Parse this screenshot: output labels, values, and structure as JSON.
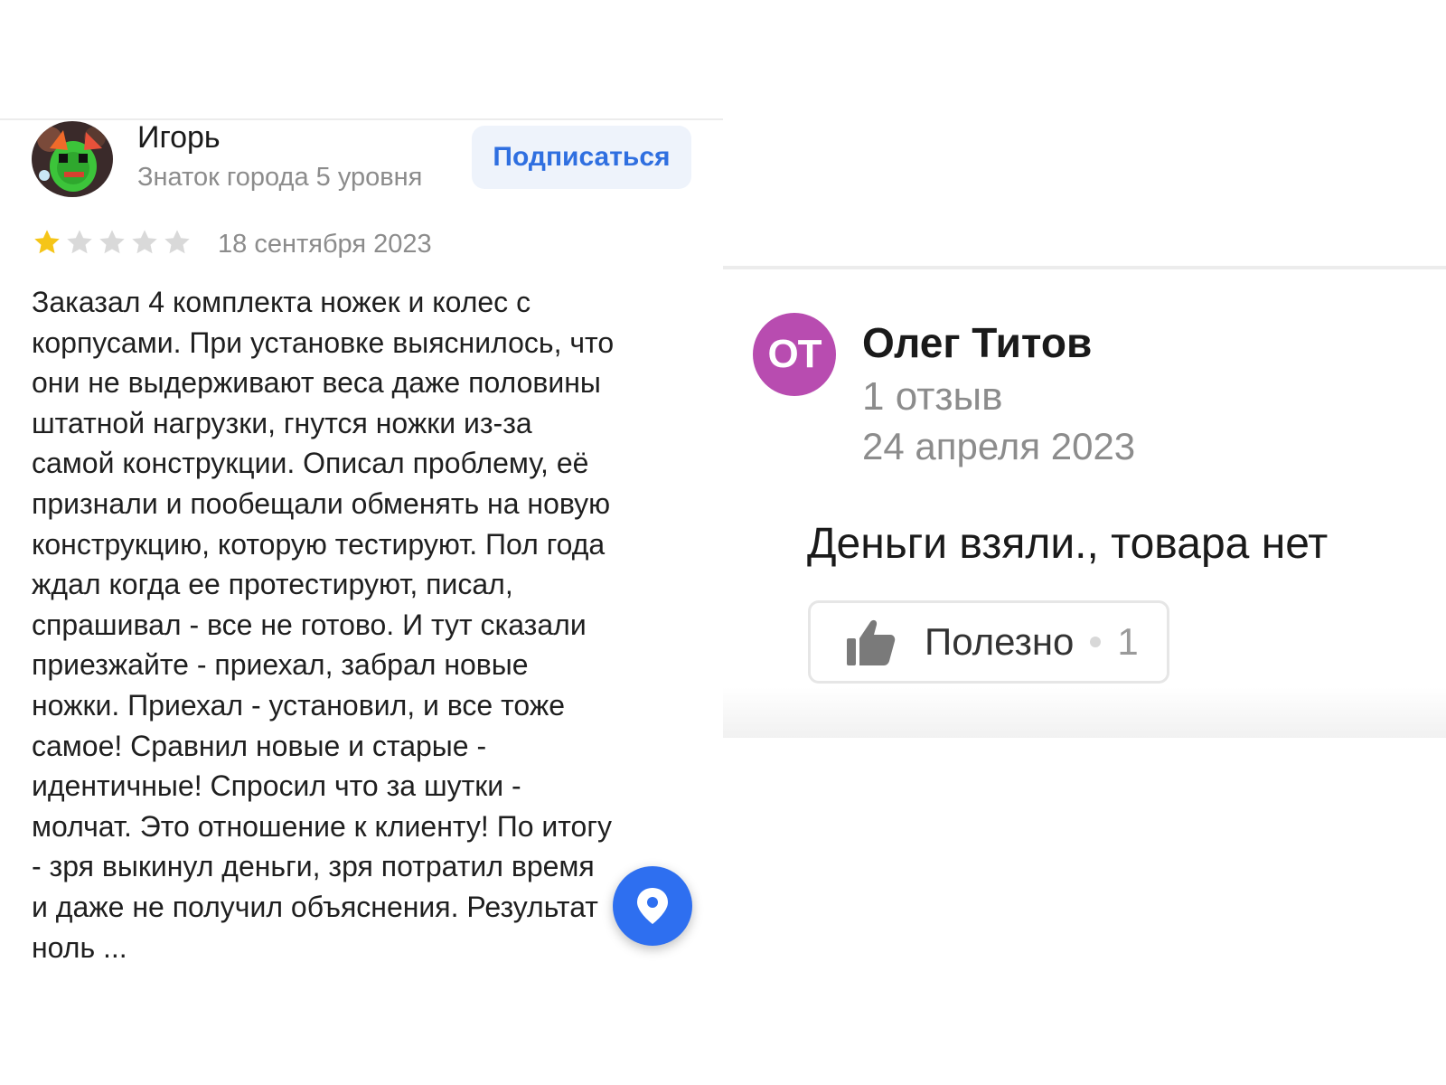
{
  "left_review": {
    "author": "Игорь",
    "level": "Знаток города 5 уровня",
    "subscribe_label": "Подписаться",
    "rating": 1,
    "rating_max": 5,
    "date": "18 сентября 2023",
    "text_lines": [
      "Заказал 4 комплекта ножек и колес с",
      "корпусами. При установке выяснилось, что",
      "они не выдерживают веса даже половины",
      "штатной нагрузки, гнутся ножки из-за",
      "самой конструкции. Описал проблему, её",
      "признали и пообещали обменять на новую",
      "конструкцию, которую тестируют. Пол года",
      "ждал когда ее протестируют, писал,",
      "спрашивал - все не готово. И тут сказали",
      "приезжайте - приехал, забрал новые",
      "ножки. Приехал - установил, и все тоже",
      "самое! Сравнил новые и старые -",
      "идентичные! Спросил что за шутки -",
      "молчат. Это отношение к клиенту! По итогу",
      "- зря выкинул деньги, зря потратил время",
      "и даже не получил объяснения. Результат",
      "ноль ..."
    ]
  },
  "right_review": {
    "avatar_initials": "ОТ",
    "author": "Олег Титов",
    "reviews_count": "1 отзыв",
    "date": "24 апреля 2023",
    "text": "Деньги взяли., товара нет",
    "useful_label": "Полезно",
    "useful_count": "1"
  },
  "colors": {
    "accent": "#2f6fe0",
    "star_active": "#f5c518",
    "star_inactive": "#d9d9d9",
    "avatar_right_bg": "#b84cb0",
    "map_button": "#2e6ff0"
  },
  "icons": {
    "map_button": "map-pin-icon",
    "useful": "thumbs-up-icon",
    "rating": "star-icon"
  }
}
